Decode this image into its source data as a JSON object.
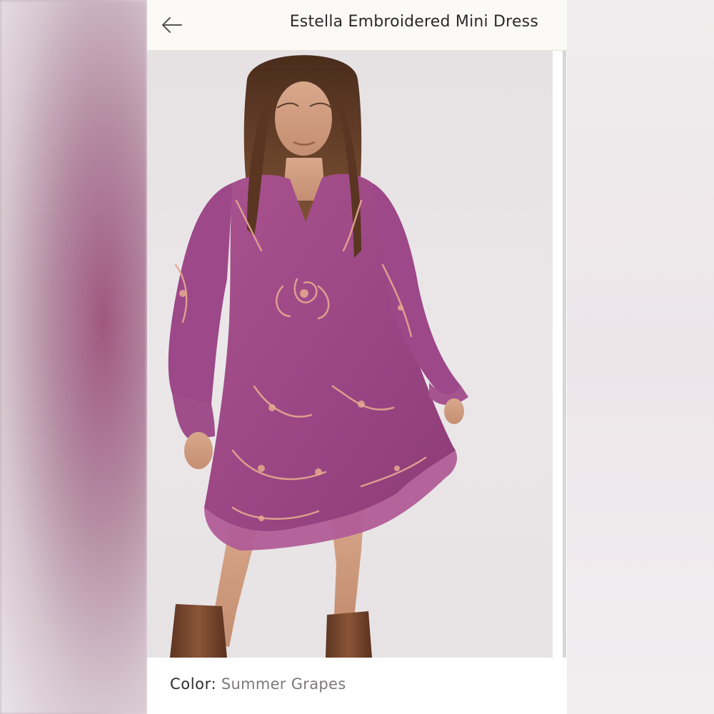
{
  "header": {
    "back_icon": "arrow-left-icon",
    "title": "Estella Embroidered Mini Dress"
  },
  "product": {
    "color_label": "Color:",
    "color_value": "Summer Grapes"
  },
  "colors": {
    "dress": "#9e4a86",
    "embroidery": "#e5a98f",
    "background": "#e8e4e6"
  }
}
